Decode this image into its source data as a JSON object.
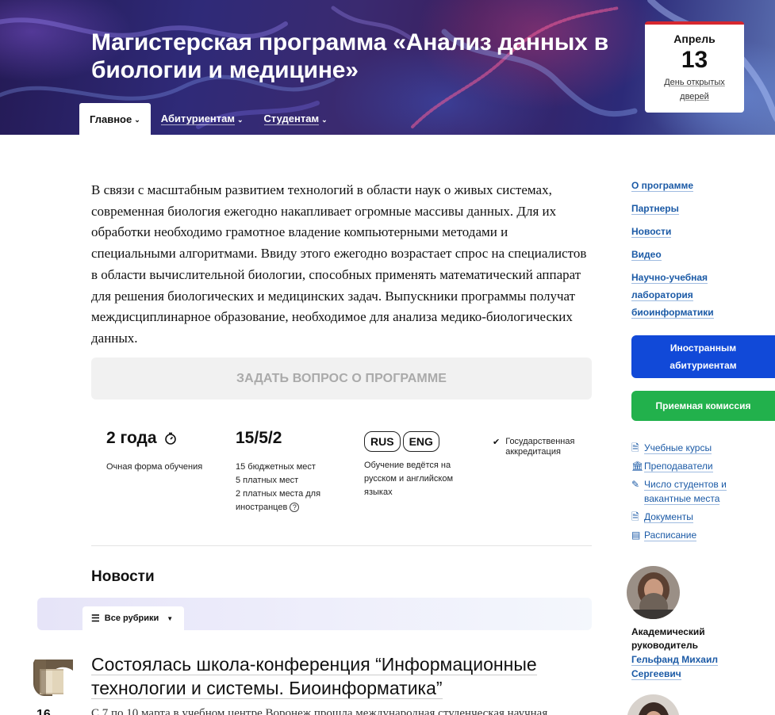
{
  "hero": {
    "title": "Магистерская программа «Анализ данных в биологии и медицине»",
    "date_card": {
      "month": "Апрель",
      "day": "13",
      "event": "День открытых дверей"
    }
  },
  "tabs": [
    {
      "label": "Главное",
      "active": true
    },
    {
      "label": "Абитуриентам",
      "active": false
    },
    {
      "label": "Студентам",
      "active": false
    }
  ],
  "intro": "В связи с масштабным развитием технологий в области наук о живых системах, современная биология ежегодно накапливает огромные массивы данных. Для их обработки необходимо грамотное владение компьютерными методами и специальными алгоритмами. Ввиду этого ежегодно возрастает спрос на специалистов в области вычислительной биологии, способных применять математический аппарат для решения биологических и медицинских задач. Выпускники программы получат междисциплинарное образование, необходимое для анализа медико-биологических данных.",
  "ask_button": "ЗАДАТЬ ВОПРОС О ПРОГРАММЕ",
  "stats": {
    "duration": {
      "value": "2 года",
      "note": "Очная форма обучения"
    },
    "places": {
      "value": "15/5/2",
      "line1": "15 бюджетных мест",
      "line2": "5 платных мест",
      "line3": "2 платных места для иностранцев"
    },
    "language": {
      "badge1": "RUS",
      "badge2": "ENG",
      "note": "Обучение ведётся на русском и английском языках"
    },
    "accreditation": "Государственная аккредитация"
  },
  "news": {
    "title": "Новости",
    "filter_label": "Все рубрики",
    "item": {
      "headline": "Состоялась школа-конференция “Информационные технологии и системы. Биоинформатика”",
      "day": "16",
      "excerpt": "С 7 по 10 марта в учебном центре Воронеж прошла международная студенческая научная"
    }
  },
  "sidebar": {
    "links": [
      "О программе",
      "Партнеры",
      "Новости",
      "Видео",
      "Научно-учебная лаборатория биоинформатики"
    ],
    "btn_foreign": "Иностранным абитуриентам",
    "btn_admission": "Приемная комиссия",
    "resources": [
      {
        "icon": "document-icon",
        "label": "Учебные курсы"
      },
      {
        "icon": "building-icon",
        "label": "Преподаватели"
      },
      {
        "icon": "pencil-icon",
        "label": "Число студентов и вакантные места"
      },
      {
        "icon": "document-icon",
        "label": "Документы"
      },
      {
        "icon": "calendar-icon",
        "label": "Расписание"
      }
    ],
    "head": {
      "role": "Академический руководитель",
      "name": "Гельфанд Михаил Сергеевич"
    }
  },
  "colors": {
    "link": "#1b5aa6",
    "blue_button": "#1149d8",
    "green_button": "#22b14c",
    "date_accent": "#d6272f"
  }
}
